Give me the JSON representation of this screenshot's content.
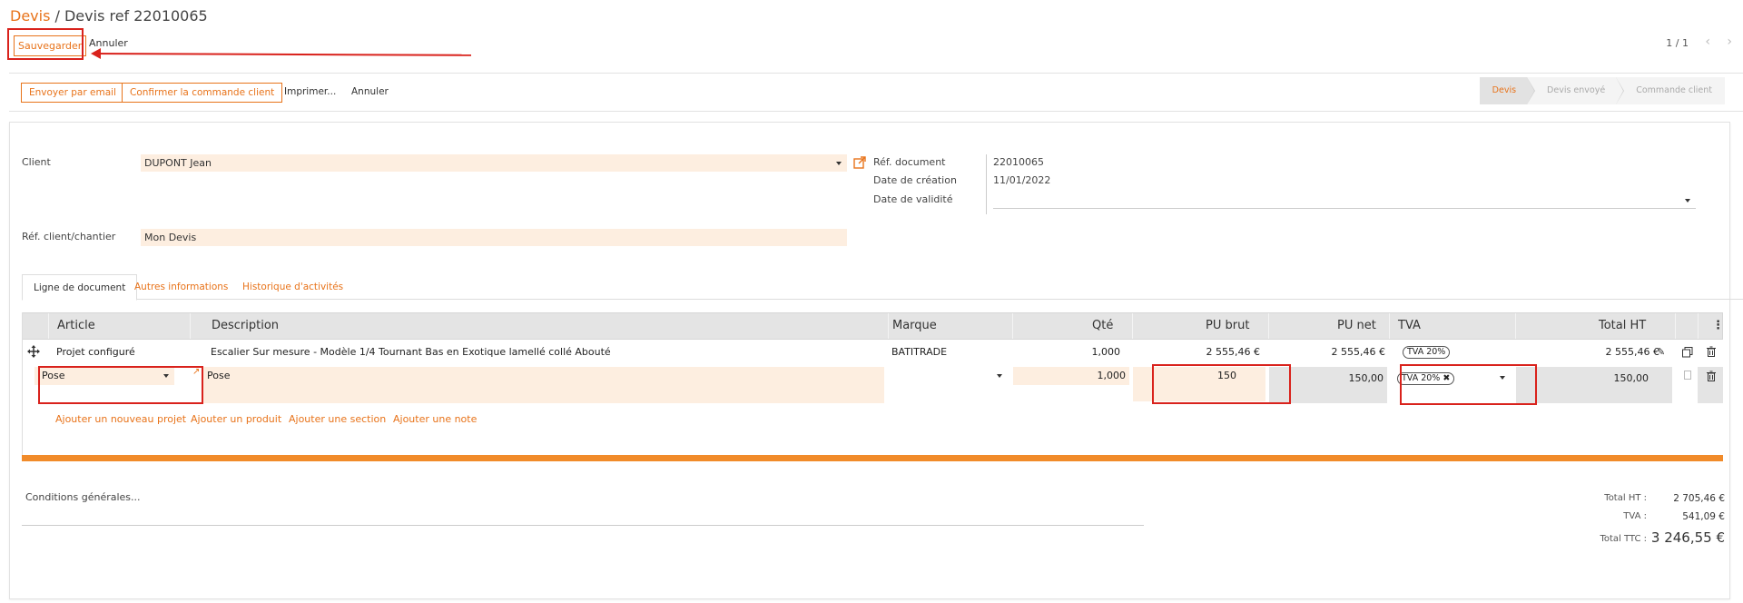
{
  "breadcrumb": {
    "parent": "Devis",
    "separator": " / ",
    "current": "Devis ref 22010065"
  },
  "toolbar": {
    "save_label": "Sauvegarder",
    "cancel_label": "Annuler"
  },
  "pager": {
    "text": "1 / 1",
    "prev": "‹",
    "next": "›"
  },
  "actions": {
    "email_label": "Envoyer par email",
    "confirm_label": "Confirmer la commande client",
    "print_label": "Imprimer...",
    "cancel_label": "Annuler"
  },
  "status": {
    "stages": [
      "Devis",
      "Devis envoyé",
      "Commande client"
    ],
    "active": "Devis"
  },
  "form": {
    "client_label": "Client",
    "client_value": "DUPONT Jean",
    "ref_client_label": "Réf. client/chantier",
    "ref_client_value": "Mon Devis",
    "doc_ref_label": "Réf. document",
    "doc_ref_value": "22010065",
    "created_label": "Date de création",
    "created_value": "11/01/2022",
    "validity_label": "Date de validité",
    "validity_value": ""
  },
  "tabs": [
    "Ligne de document",
    "Autres informations",
    "Historique d'activités"
  ],
  "table": {
    "headers": [
      "Article",
      "Description",
      "Marque",
      "Qté",
      "PU brut",
      "PU net",
      "TVA",
      "Total HT"
    ],
    "rows": [
      {
        "article": "Projet configuré",
        "description": "Escalier Sur mesure - Modèle 1/4 Tournant Bas en Exotique lamellé collé Abouté",
        "marque": "BATITRADE",
        "qty": "1,000",
        "pu_brut": "2 555,46 €",
        "pu_net": "2 555,46 €",
        "tva": "TVA 20%",
        "total_ht": "2 555,46 €"
      },
      {
        "article": "Pose",
        "description": "Pose",
        "marque": "",
        "qty": "1,000",
        "pu_brut": "150",
        "pu_net": "150,00",
        "tva": "TVA 20%",
        "total_ht": "150,00"
      }
    ],
    "add_links": [
      "Ajouter un nouveau projet",
      "Ajouter un produit",
      "Ajouter une section",
      "Ajouter une note"
    ]
  },
  "footer": {
    "conditions_label": "Conditions générales...",
    "total_ht_label": "Total HT :",
    "total_ht_value": "2 705,46 €",
    "tva_label": "TVA :",
    "tva_value": "541,09 €",
    "total_ttc_label": "Total TTC :",
    "total_ttc_value": "3 246,55 €"
  },
  "colors": {
    "accent": "#e8731a",
    "annotation": "#d9221c",
    "field_bg": "#fdeee0"
  },
  "icons": [
    "move-icon",
    "external-link-icon",
    "edit-icon",
    "copy-icon",
    "trash-icon",
    "more-icon",
    "chevron-left-icon",
    "chevron-right-icon"
  ]
}
